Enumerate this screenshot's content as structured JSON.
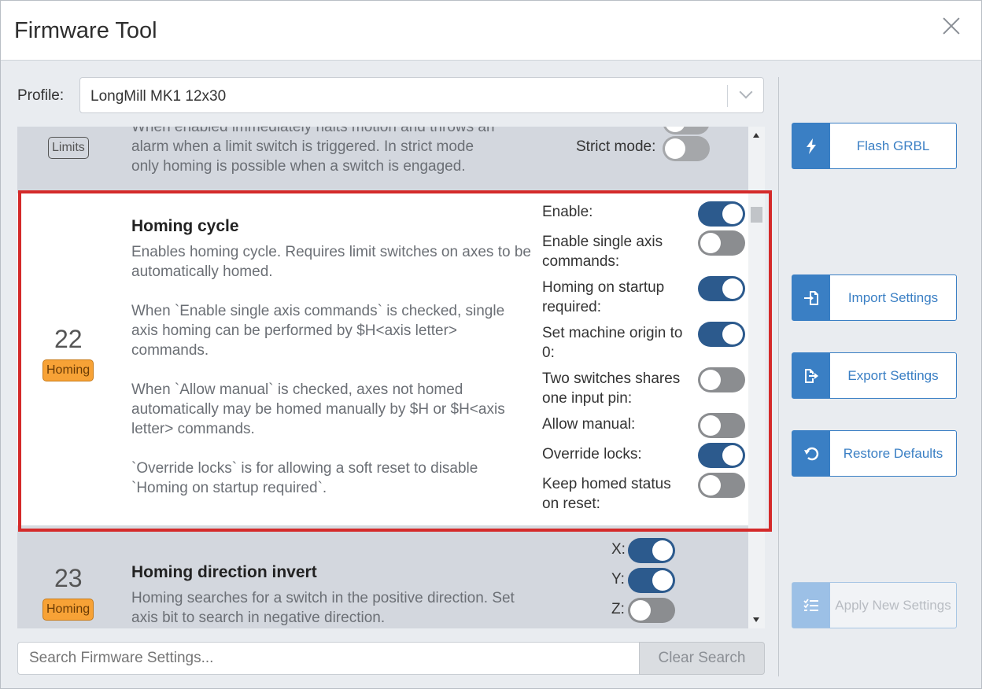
{
  "window": {
    "title": "Firmware Tool"
  },
  "profile": {
    "label": "Profile:",
    "value": "LongMill MK1 12x30"
  },
  "settings": {
    "limits_row": {
      "tag": "Limits",
      "desc_partial": "When enabled immediately halts motion and throws an",
      "desc_line2": "alarm when a limit switch is triggered. In strict mode",
      "desc_line3": "only homing is possible when a switch is engaged.",
      "option_label": "Strict mode:",
      "option_state": false
    },
    "homing_cycle": {
      "number": "22",
      "tag": "Homing",
      "title": "Homing cycle",
      "desc_p1": "Enables homing cycle. Requires limit switches on axes to be automatically homed.",
      "desc_p2": "When `Enable single axis commands` is checked, single axis homing can be performed by $H<axis letter> commands.",
      "desc_p3": "When `Allow manual` is checked, axes not homed automatically may be homed manually by $H or $H<axis letter> commands.",
      "desc_p4": "`Override locks` is for allowing a soft reset to disable `Homing on startup required`.",
      "options": [
        {
          "label": "Enable:",
          "on": true
        },
        {
          "label": "Enable single axis commands:",
          "on": false
        },
        {
          "label": "Homing on startup required:",
          "on": true
        },
        {
          "label": "Set machine origin to 0:",
          "on": true
        },
        {
          "label": "Two switches shares one input pin:",
          "on": false
        },
        {
          "label": "Allow manual:",
          "on": false
        },
        {
          "label": "Override locks:",
          "on": true
        },
        {
          "label": "Keep homed status on reset:",
          "on": false
        }
      ]
    },
    "homing_dir": {
      "number": "23",
      "tag": "Homing",
      "title": "Homing direction invert",
      "desc": "Homing searches for a switch in the positive direction. Set axis bit to search in negative direction.",
      "axes": [
        {
          "label": "X:",
          "on": true
        },
        {
          "label": "Y:",
          "on": true
        },
        {
          "label": "Z:",
          "on": false
        }
      ]
    }
  },
  "search": {
    "placeholder": "Search Firmware Settings...",
    "clear_label": "Clear Search"
  },
  "actions": {
    "flash": "Flash GRBL",
    "import": "Import Settings",
    "export": "Export Settings",
    "restore": "Restore Defaults",
    "apply": "Apply New Settings"
  },
  "colors": {
    "toggle_on": "#2c5a8d",
    "toggle_off": "#8b8d90",
    "accent": "#3a7fc4",
    "homing_tag": "#f7a236",
    "highlight": "#d42a2a"
  }
}
